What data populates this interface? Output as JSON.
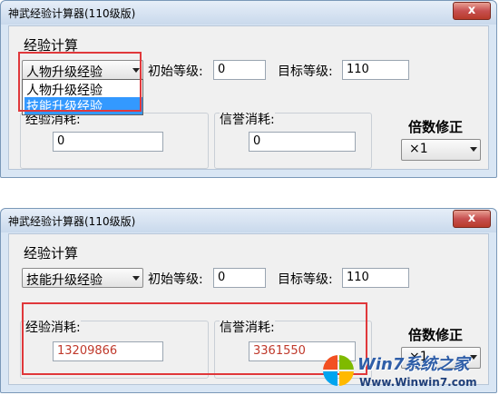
{
  "window1": {
    "title": "神武经验计算器(110级版)",
    "close_label": "x",
    "group_title": "经验计算",
    "mode_value": "人物升级经验",
    "mode_options": [
      "人物升级经验",
      "技能升级经验"
    ],
    "initial_level_label": "初始等级:",
    "initial_level_value": "0",
    "target_level_label": "目标等级:",
    "target_level_value": "110",
    "exp_cost_label": "经验消耗:",
    "exp_cost_value": "0",
    "credit_cost_label": "信誉消耗:",
    "credit_cost_value": "0",
    "multiplier_label": "倍数修正",
    "multiplier_value": "×1"
  },
  "window2": {
    "title": "神武经验计算器(110级版)",
    "close_label": "x",
    "group_title": "经验计算",
    "mode_value": "技能升级经验",
    "initial_level_label": "初始等级:",
    "initial_level_value": "0",
    "target_level_label": "目标等级:",
    "target_level_value": "110",
    "exp_cost_label": "经验消耗:",
    "exp_cost_value": "13209866",
    "credit_cost_label": "信誉消耗:",
    "credit_cost_value": "3361550",
    "multiplier_label": "倍数修正",
    "multiplier_value": "×1"
  },
  "watermark": {
    "brand": "Win7系统之家",
    "url": "Www.Winwin7.com"
  },
  "colors": {
    "highlight_border": "#e0383b",
    "selection": "#3399ff",
    "result_text": "#c0392b"
  }
}
